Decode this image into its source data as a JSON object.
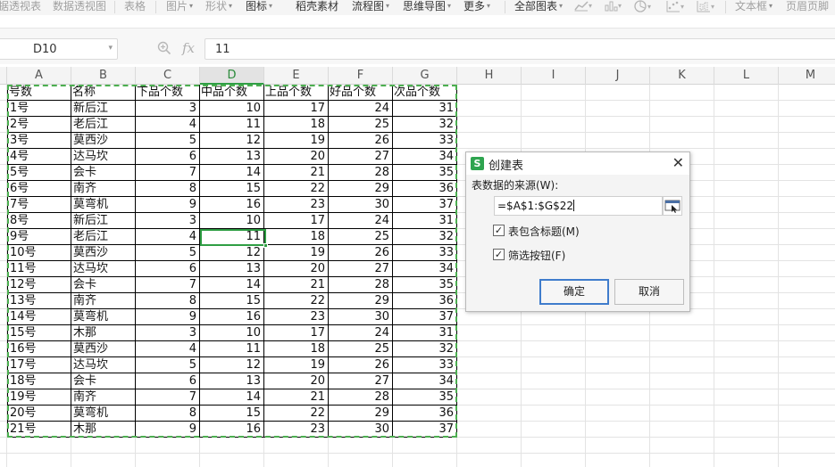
{
  "ribbon": {
    "items": [
      "据透视表",
      "数据透视图",
      "表格",
      "图片",
      "形状",
      "图标",
      "稻壳素材",
      "流程图",
      "思维导图",
      "更多",
      "全部图表",
      "文本框",
      "页眉页脚"
    ]
  },
  "formula_bar": {
    "name_box": "D10",
    "fx_icon": "fx",
    "formula": "11"
  },
  "columns": [
    "A",
    "B",
    "C",
    "D",
    "E",
    "F",
    "G",
    "H",
    "I",
    "J",
    "K",
    "L",
    "M"
  ],
  "selected_column": "D",
  "sheet": {
    "headers": [
      "号数",
      "名称",
      "下品个数",
      "中品个数",
      "上品个数",
      "好品个数",
      "次品个数"
    ],
    "rows": [
      [
        "1号",
        "新后江",
        "3",
        "10",
        "17",
        "24",
        "31"
      ],
      [
        "2号",
        "老后江",
        "4",
        "11",
        "18",
        "25",
        "32"
      ],
      [
        "3号",
        "莫西沙",
        "5",
        "12",
        "19",
        "26",
        "33"
      ],
      [
        "4号",
        "达马坎",
        "6",
        "13",
        "20",
        "27",
        "34"
      ],
      [
        "5号",
        "会卡",
        "7",
        "14",
        "21",
        "28",
        "35"
      ],
      [
        "6号",
        "南齐",
        "8",
        "15",
        "22",
        "29",
        "36"
      ],
      [
        "7号",
        "莫弯机",
        "9",
        "16",
        "23",
        "30",
        "37"
      ],
      [
        "8号",
        "新后江",
        "3",
        "10",
        "17",
        "24",
        "31"
      ],
      [
        "9号",
        "老后江",
        "4",
        "11",
        "18",
        "25",
        "32"
      ],
      [
        "10号",
        "莫西沙",
        "5",
        "12",
        "19",
        "26",
        "33"
      ],
      [
        "11号",
        "达马坎",
        "6",
        "13",
        "20",
        "27",
        "34"
      ],
      [
        "12号",
        "会卡",
        "7",
        "14",
        "21",
        "28",
        "35"
      ],
      [
        "13号",
        "南齐",
        "8",
        "15",
        "22",
        "29",
        "36"
      ],
      [
        "14号",
        "莫弯机",
        "9",
        "16",
        "23",
        "30",
        "37"
      ],
      [
        "15号",
        "木那",
        "3",
        "10",
        "17",
        "24",
        "31"
      ],
      [
        "16号",
        "莫西沙",
        "4",
        "11",
        "18",
        "25",
        "32"
      ],
      [
        "17号",
        "达马坎",
        "5",
        "12",
        "19",
        "26",
        "33"
      ],
      [
        "18号",
        "会卡",
        "6",
        "13",
        "20",
        "27",
        "34"
      ],
      [
        "19号",
        "南齐",
        "7",
        "14",
        "21",
        "28",
        "35"
      ],
      [
        "20号",
        "莫弯机",
        "8",
        "15",
        "22",
        "29",
        "36"
      ],
      [
        "21号",
        "木那",
        "9",
        "16",
        "23",
        "30",
        "37"
      ]
    ]
  },
  "dialog": {
    "logo": "S",
    "title": "创建表",
    "close": "✕",
    "source_label": "表数据的来源(W):",
    "range_value": "=$A$1:$G$22",
    "has_header_label": "表包含标题(M)",
    "has_header_checked": true,
    "filter_label": "筛选按钮(F)",
    "filter_checked": true,
    "ok_label": "确定",
    "cancel_label": "取消"
  },
  "colors": {
    "accent_green": "#2f9e44",
    "marquee_green": "#4caf50",
    "primary_button_border": "#3f7ccc",
    "logo_green": "#2ea44f"
  }
}
